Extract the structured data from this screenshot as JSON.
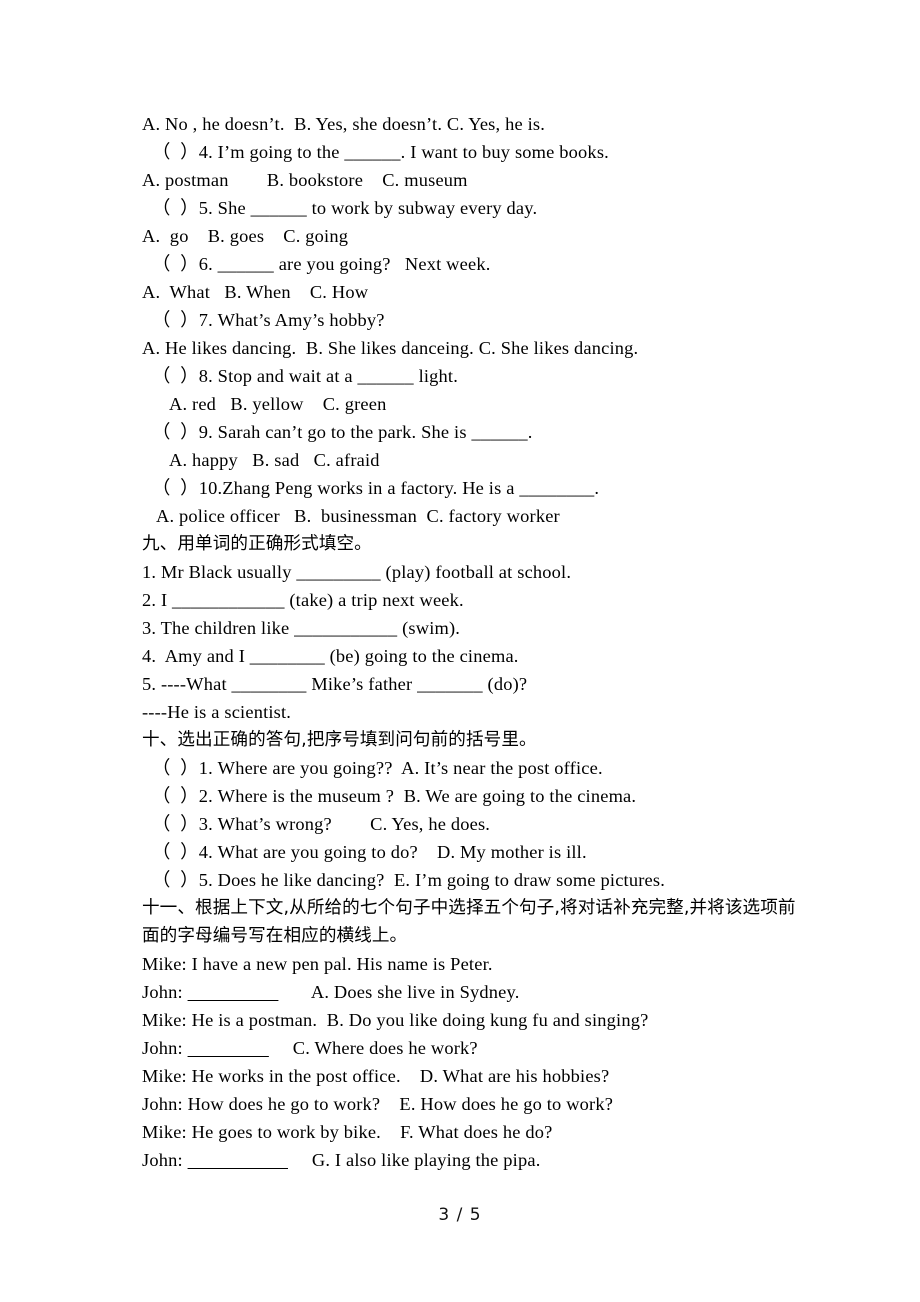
{
  "document": {
    "type": "english-exam-worksheet",
    "page_label": "3 / 5",
    "page_number": 3,
    "page_total": 5
  },
  "multiple_choice_continued": {
    "q3_options": "A. No , he doesn’t.  B. Yes, she doesn’t. C. Yes, he is.",
    "items": [
      {
        "stem": "（  ）4. I’m going to the ______. I want to buy some books.",
        "options": "A. postman        B. bookstore    C. museum"
      },
      {
        "stem": "（  ）5. She ______ to work by subway every day.",
        "options": "A.  go    B. goes    C. going"
      },
      {
        "stem": "（  ）6. ______ are you going?   Next week.",
        "options": "A.  What   B. When    C. How"
      },
      {
        "stem": "（  ）7. What’s Amy’s hobby?",
        "options": "A. He likes dancing.  B. She likes danceing. C. She likes dancing."
      },
      {
        "stem": "（  ）8. Stop and wait at a ______ light.",
        "options": "A. red   B. yellow    C. green"
      },
      {
        "stem": "（  ）9. Sarah can’t go to the park. She is ______.",
        "options": "A. happy   B. sad   C. afraid"
      },
      {
        "stem": "（  ）10.Zhang Peng works in a factory. He is a ________.",
        "options": "A. police officer   B.  businessman  C. factory worker"
      }
    ]
  },
  "section_nine": {
    "heading": "九、用单词的正确形式填空。",
    "items": [
      "1. Mr Black usually _________ (play) football at school.",
      "2. I ____________ (take) a trip next week.",
      "3. The children like ___________ (swim).",
      "4.  Amy and I ________ (be) going to the cinema.",
      "5. ----What ________ Mike’s father _______ (do)?",
      "----He is a scientist."
    ]
  },
  "section_ten": {
    "heading": "十、选出正确的答句,把序号填到问句前的括号里。",
    "items": [
      "（  ）1. Where are you going??  A. It’s near the post office.",
      "（  ）2. Where is the museum ?  B. We are going to the cinema.",
      "（  ）3. What’s wrong?        C. Yes, he does.",
      "（  ）4. What are you going to do?    D. My mother is ill.",
      "（  ）5. Does he like dancing?  E. I’m going to draw some pictures."
    ]
  },
  "section_eleven": {
    "heading": "十一、根据上下文,从所给的七个句子中选择五个句子,将对话补充完整,并将该选项前面的字母编号写在相应的横线上。",
    "dialogue": [
      {
        "speaker": "Mike: ",
        "text": "I have a new pen pal. His name is Peter.",
        "blank": false,
        "choice": ""
      },
      {
        "speaker": "John: ",
        "text": "",
        "blank": true,
        "choice": "A. Does she live in Sydney."
      },
      {
        "speaker": "Mike: ",
        "text": "He is a postman.",
        "blank": false,
        "choice": "B. Do you like doing kung fu and singing?"
      },
      {
        "speaker": "John: ",
        "text": "",
        "blank": true,
        "choice": "C. Where does he work?"
      },
      {
        "speaker": "Mike: ",
        "text": "He works in the post office.",
        "blank": false,
        "choice": "D. What are his hobbies?"
      },
      {
        "speaker": "John: ",
        "text": "How does he go to work?",
        "blank": false,
        "choice": "E. How does he go to work?"
      },
      {
        "speaker": "Mike: ",
        "text": "He goes to work by bike.",
        "blank": false,
        "choice": "F. What does he do?"
      },
      {
        "speaker": "John: ",
        "text": "",
        "blank": true,
        "choice": "G. I also like playing the pipa."
      }
    ]
  }
}
